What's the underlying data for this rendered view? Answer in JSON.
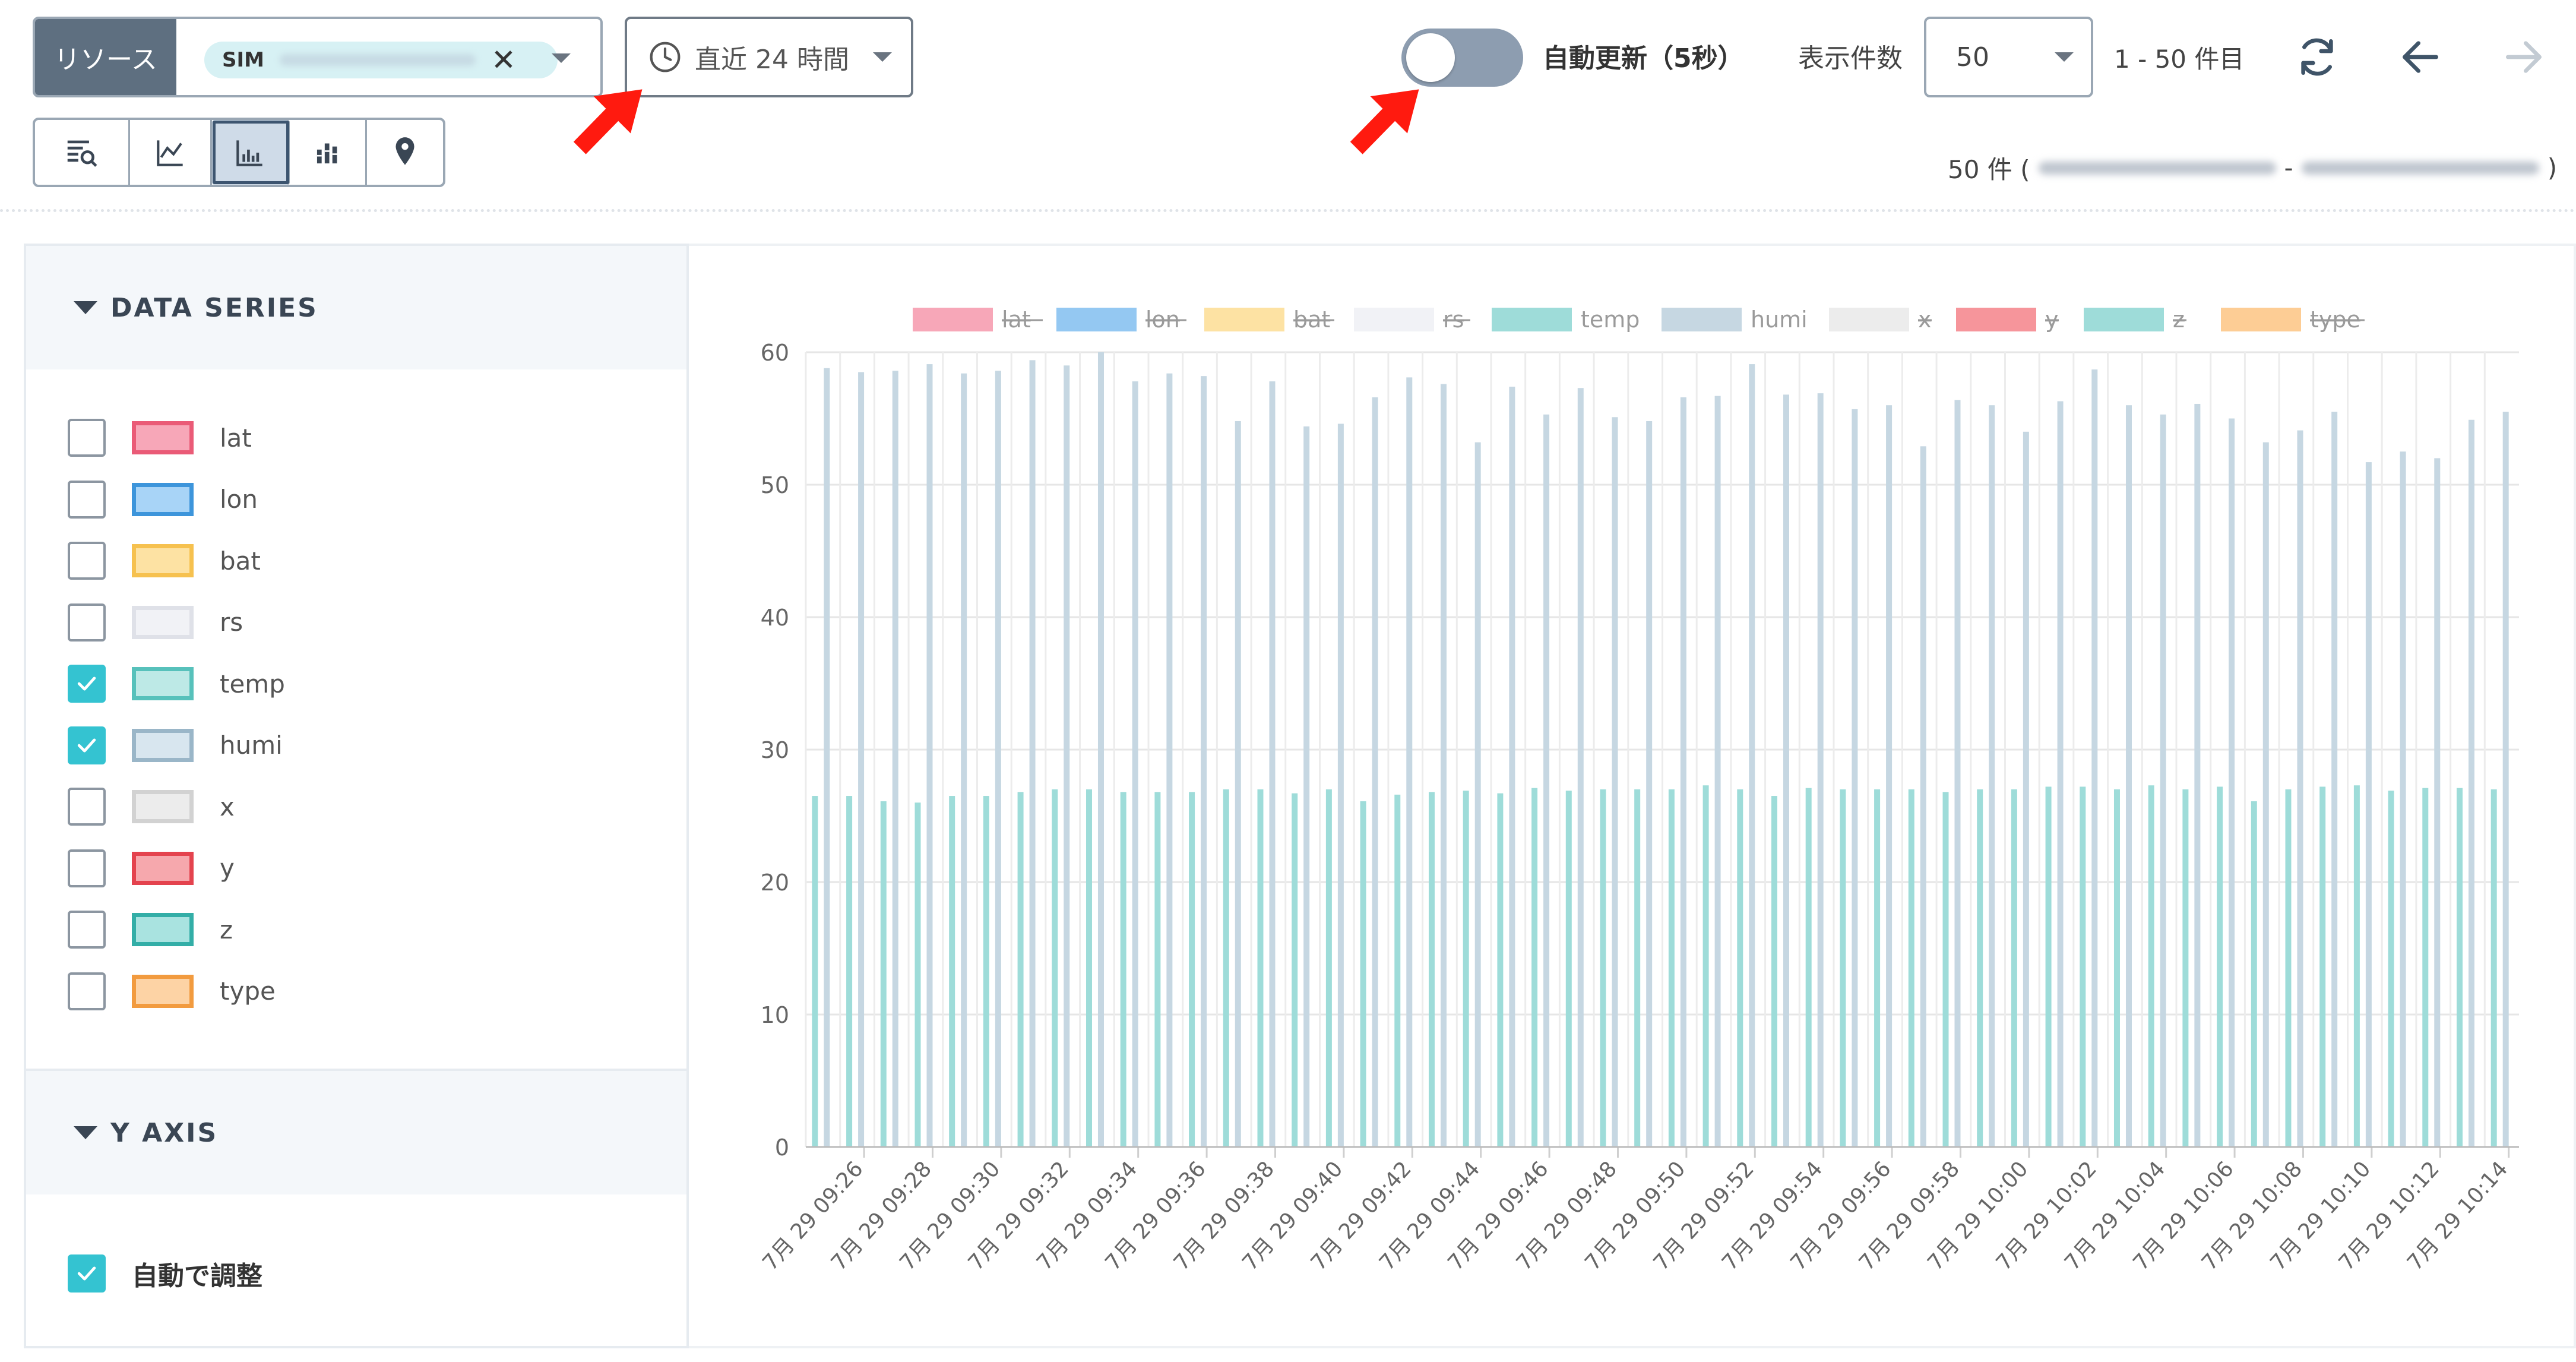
{
  "resource": {
    "label": "リソース",
    "chip_tag": "SIM"
  },
  "time_range": {
    "label": "直近 24 時間"
  },
  "auto_refresh": {
    "label": "自動更新（5秒）",
    "enabled": false
  },
  "page_size": {
    "label": "表示件数",
    "value": "50"
  },
  "range_label": "1 - 50 件目",
  "count_info": {
    "prefix": "50 件 (",
    "separator": "-",
    "suffix": ")"
  },
  "views": [
    {
      "icon": "table-search-icon",
      "active": false
    },
    {
      "icon": "line-chart-icon",
      "active": false
    },
    {
      "icon": "bar-chart-icon",
      "active": true
    },
    {
      "icon": "stacked-bar-icon",
      "active": false
    },
    {
      "icon": "map-pin-icon",
      "active": false
    }
  ],
  "data_series_section": {
    "title": "DATA SERIES",
    "items": [
      {
        "name": "lat",
        "checked": false,
        "fill": "#f7a7b8",
        "border": "#ea5b77"
      },
      {
        "name": "lon",
        "checked": false,
        "fill": "#a8d4f7",
        "border": "#3d95db"
      },
      {
        "name": "bat",
        "checked": false,
        "fill": "#fde2a3",
        "border": "#f6c14f"
      },
      {
        "name": "rs",
        "checked": false,
        "fill": "#f1f2f6",
        "border": "#dfe1e8"
      },
      {
        "name": "temp",
        "checked": true,
        "fill": "#bde9e6",
        "border": "#57c1bb"
      },
      {
        "name": "humi",
        "checked": true,
        "fill": "#d8e6ef",
        "border": "#9ab6c8"
      },
      {
        "name": "x",
        "checked": false,
        "fill": "#ececec",
        "border": "#d2d2d2"
      },
      {
        "name": "y",
        "checked": false,
        "fill": "#f6a8ad",
        "border": "#e4434e"
      },
      {
        "name": "z",
        "checked": false,
        "fill": "#a9e3e0",
        "border": "#33aea7"
      },
      {
        "name": "type",
        "checked": false,
        "fill": "#fdd3a5",
        "border": "#f29b3f"
      }
    ]
  },
  "y_axis_section": {
    "title": "Y AXIS",
    "auto_adjust": {
      "label": "自動で調整",
      "checked": true
    }
  },
  "colors": {
    "accent": "#34c3d1",
    "header_gray": "#5e6f80",
    "arrow_red": "#ff1a0f"
  },
  "chart_data": {
    "type": "bar",
    "ylim": [
      0,
      60
    ],
    "yticks": [
      0,
      10,
      20,
      30,
      40,
      50,
      60
    ],
    "legend": [
      {
        "name": "lat",
        "color": "#f7a7b8",
        "hidden": true
      },
      {
        "name": "lon",
        "color": "#94c8f2",
        "hidden": true
      },
      {
        "name": "bat",
        "color": "#fde2a3",
        "hidden": true
      },
      {
        "name": "rs",
        "color": "#f1f2f6",
        "hidden": true
      },
      {
        "name": "temp",
        "color": "#9edcd9",
        "hidden": false
      },
      {
        "name": "humi",
        "color": "#c6d7e2",
        "hidden": false
      },
      {
        "name": "x",
        "color": "#ececec",
        "hidden": true
      },
      {
        "name": "y",
        "color": "#f6959b",
        "hidden": true
      },
      {
        "name": "z",
        "color": "#9edcd9",
        "hidden": true
      },
      {
        "name": "type",
        "color": "#fdcd95",
        "hidden": true
      }
    ],
    "legend_position": "top",
    "grid": true,
    "x_tick_labels": [
      "7月 29 09:26",
      "7月 29 09:28",
      "7月 29 09:30",
      "7月 29 09:32",
      "7月 29 09:34",
      "7月 29 09:36",
      "7月 29 09:38",
      "7月 29 09:40",
      "7月 29 09:42",
      "7月 29 09:44",
      "7月 29 09:46",
      "7月 29 09:48",
      "7月 29 09:50",
      "7月 29 09:52",
      "7月 29 09:54",
      "7月 29 09:56",
      "7月 29 09:58",
      "7月 29 10:00",
      "7月 29 10:02",
      "7月 29 10:04",
      "7月 29 10:06",
      "7月 29 10:08",
      "7月 29 10:10",
      "7月 29 10:12",
      "7月 29 10:14"
    ],
    "series": [
      {
        "name": "temp",
        "color": "#9edcd9",
        "values": [
          26.5,
          26.5,
          26.1,
          26.0,
          26.5,
          26.5,
          26.8,
          27.0,
          27.0,
          26.8,
          26.8,
          26.8,
          27.0,
          27.0,
          26.7,
          27.0,
          26.1,
          26.6,
          26.8,
          26.9,
          26.7,
          27.1,
          26.9,
          27.0,
          27.0,
          27.0,
          27.3,
          27.0,
          26.5,
          27.1,
          27.0,
          27.0,
          27.0,
          26.8,
          27.0,
          27.0,
          27.2,
          27.2,
          27.0,
          27.3,
          27.0,
          27.2,
          26.1,
          27.0,
          27.2,
          27.3,
          26.9,
          27.1,
          27.1,
          27.0
        ]
      },
      {
        "name": "humi",
        "color": "#c6d7e2",
        "values": [
          58.8,
          58.5,
          58.6,
          59.1,
          58.4,
          58.6,
          59.4,
          59.0,
          60.0,
          57.8,
          58.4,
          58.2,
          54.8,
          57.8,
          54.4,
          54.6,
          56.6,
          58.1,
          57.6,
          53.2,
          57.4,
          55.3,
          57.3,
          55.1,
          54.8,
          56.6,
          56.7,
          59.1,
          56.8,
          56.9,
          55.7,
          56.0,
          52.9,
          56.4,
          56.0,
          54.0,
          56.3,
          58.7,
          56.0,
          55.3,
          56.1,
          55.0,
          53.2,
          54.1,
          55.5,
          51.7,
          52.5,
          52.0,
          54.9,
          55.5
        ]
      }
    ]
  }
}
